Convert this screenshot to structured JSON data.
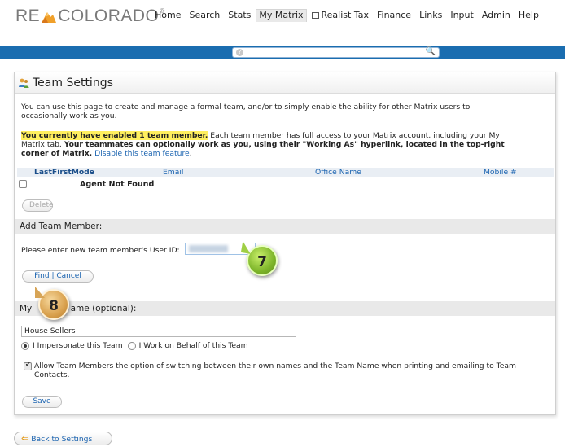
{
  "app": {
    "logo_left": "RE",
    "logo_right": "COLORADO",
    "logo_reg": "®"
  },
  "nav": {
    "items": [
      "Home",
      "Search",
      "Stats",
      "My Matrix",
      "Realist Tax",
      "Finance",
      "Links",
      "Input",
      "Admin",
      "Help"
    ],
    "active": "My Matrix"
  },
  "search": {
    "placeholder": ""
  },
  "page": {
    "title": "Team Settings",
    "intro": "You can use this page to create and manage a formal team, and/or to simply enable the ability for other Matrix users to occasionally work as you.",
    "notice_highlight": "You currently have enabled 1 team member.",
    "notice_text1": " Each team member has full access to your Matrix account, including your My Matrix tab. ",
    "notice_bold": "Your teammates can optionally work as you, using their \"Working As\" hyperlink, located in the top-right corner of Matrix.",
    "notice_link": "Disable this team feature",
    "notice_end": "."
  },
  "table": {
    "headers": [
      "LastFirstMode",
      "Email",
      "Office Name",
      "Mobile #"
    ],
    "rows": [
      {
        "name": "Agent Not Found"
      }
    ],
    "delete_label": "Delete"
  },
  "add_member": {
    "header": "Add Team Member:",
    "label": "Please enter new team member's User ID:",
    "find_label": "Find",
    "cancel_label": "Cancel"
  },
  "team_name": {
    "header_start": "My ",
    "header_end": "ame (optional):",
    "value": "House Sellers",
    "radio1": "I Impersonate this Team",
    "radio2": "I Work on Behalf of this Team",
    "allow_text": "Allow Team Members the option of switching between their own names and the Team Name when printing and emailing to Team Contacts.",
    "save_label": "Save"
  },
  "back_label": "Back to Settings",
  "callouts": {
    "seven": "7",
    "eight": "8"
  },
  "colors": {
    "nav_bar": "#1a6db0",
    "highlight": "#ffef5e",
    "link": "#1a63b0"
  }
}
